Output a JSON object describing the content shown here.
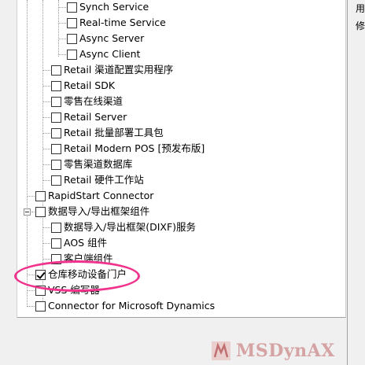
{
  "tree": {
    "items": [
      {
        "label": "Synch Service",
        "checked": false
      },
      {
        "label": "Real-time Service",
        "checked": false
      },
      {
        "label": "Async Server",
        "checked": false
      },
      {
        "label": "Async Client",
        "checked": false
      },
      {
        "label": "Retail 渠道配置实用程序",
        "checked": false
      },
      {
        "label": "Retail SDK",
        "checked": false
      },
      {
        "label": "零售在线渠道",
        "checked": false
      },
      {
        "label": "Retail Server",
        "checked": false
      },
      {
        "label": "Retail 批量部署工具包",
        "checked": false
      },
      {
        "label": "Retail Modern POS [预发布版]",
        "checked": false
      },
      {
        "label": "零售渠道数据库",
        "checked": false
      },
      {
        "label": "Retail 硬件工作站",
        "checked": false
      },
      {
        "label": "RapidStart Connector",
        "checked": false
      },
      {
        "label": "数据导入/导出框架组件",
        "checked": false
      },
      {
        "label": "数据导入/导出框架(DIXF)服务",
        "checked": false
      },
      {
        "label": "AOS 组件",
        "checked": false
      },
      {
        "label": "客户端组件",
        "checked": false
      },
      {
        "label": "仓库移动设备门户",
        "checked": true
      },
      {
        "label": "VSS 编写器",
        "checked": false
      },
      {
        "label": "Connector for Microsoft Dynamics",
        "checked": false
      }
    ]
  },
  "right_panel": {
    "line1": "用",
    "line2": "修"
  },
  "watermark": {
    "text": "MSDynAX"
  },
  "colors": {
    "highlight": "#f0328c",
    "watermark": "#cc8a8a"
  }
}
